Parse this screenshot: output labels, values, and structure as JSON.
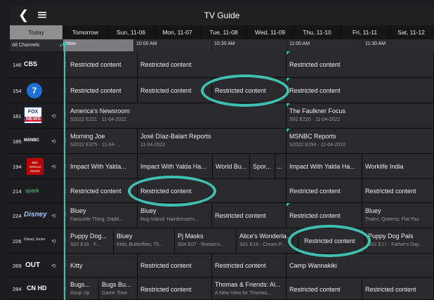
{
  "header": {
    "title": "TV Guide",
    "back_icon": "chevron-left-icon",
    "menu_icon": "hamburger-menu-icon"
  },
  "days": [
    "Today",
    "Tomorrow",
    "Sun, 11-06",
    "Mon, 11-07",
    "Tue, 11-08",
    "Wed, 11-09",
    "Thu, 11-10",
    "Fri, 11-11",
    "Sat, 11-12"
  ],
  "selected_day": "Today",
  "timebar": {
    "all_channels": "All Channels",
    "now": "Now",
    "times": [
      "10:00 AM",
      "10:30 AM",
      "11:00 AM",
      "11:30 AM"
    ]
  },
  "accent_color": "#39c2b4",
  "channels": [
    {
      "number": "146",
      "logo": "CBS",
      "programs": [
        {
          "title": "Restricted content",
          "sub": ""
        },
        {
          "title": "Restricted content",
          "sub": ""
        },
        {
          "title": "Restricted content",
          "sub": ""
        }
      ]
    },
    {
      "number": "154",
      "logo": "7abc",
      "programs": [
        {
          "title": "Restricted content",
          "sub": ""
        },
        {
          "title": "Restricted content",
          "sub": ""
        },
        {
          "title": "Restricted content",
          "sub": ""
        },
        {
          "title": "Restricted content",
          "sub": ""
        }
      ]
    },
    {
      "number": "181",
      "logo": "FOX NEWS",
      "programs": [
        {
          "title": "America's Newsroom",
          "sub": "S2022 E221 · 11-04-2022"
        },
        {
          "title": "The Faulkner Focus",
          "sub": "S02 E220 · 11-04-2022"
        }
      ]
    },
    {
      "number": "185",
      "logo": "MSNBC",
      "programs": [
        {
          "title": "Morning Joe",
          "sub": "S2022 E375 · 11-04-..."
        },
        {
          "title": "José Díaz-Balart Reports",
          "sub": "11-04-2022"
        },
        {
          "title": "MSNBC Reports",
          "sub": "S2022 E294 · 11-04-2022"
        }
      ]
    },
    {
      "number": "194",
      "logo": "BBC WORLD NEWS",
      "programs": [
        {
          "title": "Impact With Yalda...",
          "sub": ""
        },
        {
          "title": "Impact With Yalda Ha...",
          "sub": ""
        },
        {
          "title": "World Bu...",
          "sub": ""
        },
        {
          "title": "Spor...",
          "sub": ""
        },
        {
          "title": "...",
          "sub": ""
        },
        {
          "title": "Impact With Yalda Ha...",
          "sub": ""
        },
        {
          "title": "Worklife India",
          "sub": ""
        }
      ]
    },
    {
      "number": "214",
      "logo": "spark",
      "programs": [
        {
          "title": "Restricted content",
          "sub": ""
        },
        {
          "title": "Restricted content",
          "sub": ""
        },
        {
          "title": "Restricted content",
          "sub": ""
        },
        {
          "title": "Restricted content",
          "sub": ""
        }
      ]
    },
    {
      "number": "224",
      "logo": "Disney",
      "programs": [
        {
          "title": "Bluey",
          "sub": "Favourite Thing; Dadd..."
        },
        {
          "title": "Bluey",
          "sub": "Rug Island; Hairdressers..."
        },
        {
          "title": "Restricted content",
          "sub": ""
        },
        {
          "title": "Restricted content",
          "sub": ""
        },
        {
          "title": "Bluey",
          "sub": "Trains; Queens; Flat Pac"
        }
      ]
    },
    {
      "number": "226",
      "logo": "Disney Junior",
      "programs": [
        {
          "title": "Puppy Dog...",
          "sub": "S02 E16 · F..."
        },
        {
          "title": "Bluey",
          "sub": "Kids; Butterflies; Th..."
        },
        {
          "title": "Pj Masks",
          "sub": "S04 E07 · Romeo's..."
        },
        {
          "title": "Alice's Wonderla...",
          "sub": "S01 E19 · Cream P..."
        },
        {
          "title": "Restricted content",
          "sub": ""
        },
        {
          "title": "Puppy Dog Pals",
          "sub": "S02 E17 · Father's Day..."
        }
      ]
    },
    {
      "number": "269",
      "logo": "OUT",
      "programs": [
        {
          "title": "Kitty",
          "sub": ""
        },
        {
          "title": "Restricted content",
          "sub": ""
        },
        {
          "title": "Restricted content",
          "sub": ""
        },
        {
          "title": "Camp Wannakiki",
          "sub": ""
        }
      ]
    },
    {
      "number": "284",
      "logo": "CN HD",
      "programs": [
        {
          "title": "Bugs...",
          "sub": "Soup Up"
        },
        {
          "title": "Bugs Bu...",
          "sub": "Game Time"
        },
        {
          "title": "Restricted content",
          "sub": ""
        },
        {
          "title": "Thomas & Friends: Al...",
          "sub": "A New View for Thomas;..."
        },
        {
          "title": "Restricted content",
          "sub": ""
        },
        {
          "title": "Restricted content",
          "sub": ""
        }
      ]
    }
  ]
}
